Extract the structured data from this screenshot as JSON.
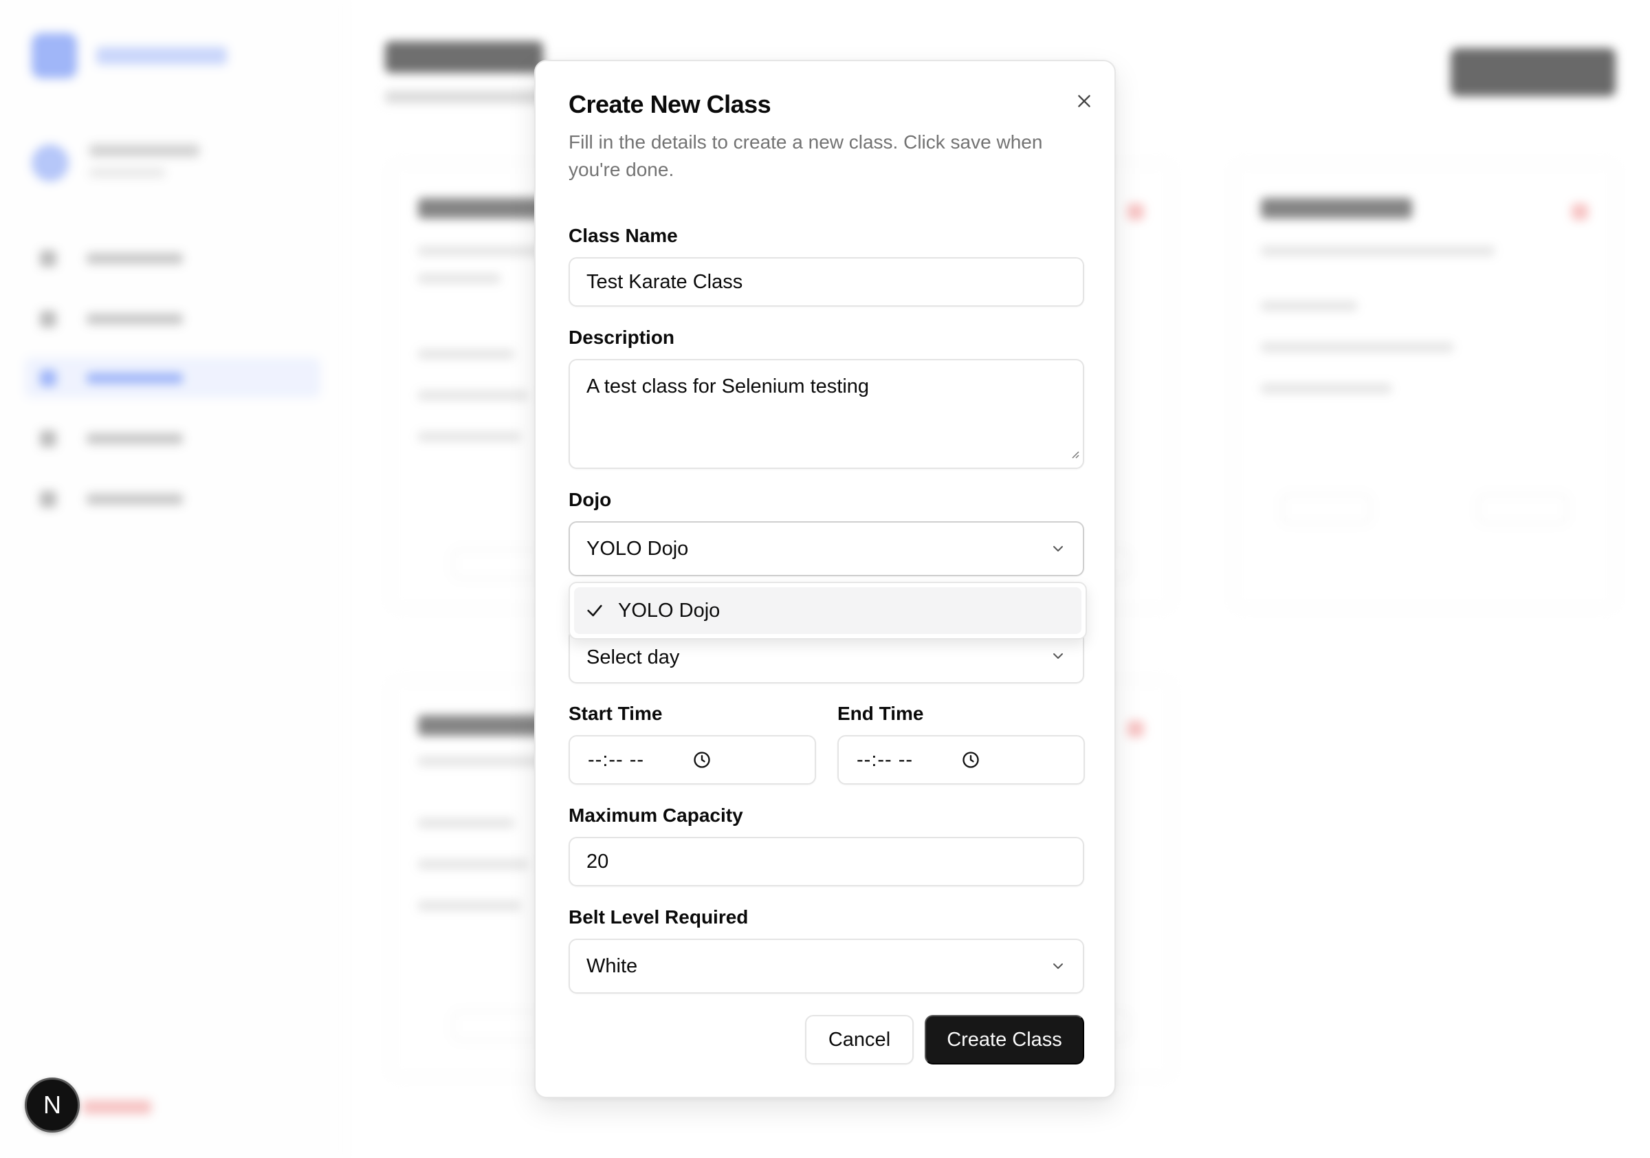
{
  "dialog": {
    "title": "Create New Class",
    "description": "Fill in the details to create a new class. Click save when you're done."
  },
  "form": {
    "class_name": {
      "label": "Class Name",
      "value": "Test Karate Class"
    },
    "description": {
      "label": "Description",
      "value": "A test class for Selenium testing"
    },
    "dojo": {
      "label": "Dojo",
      "value": "YOLO Dojo",
      "options": [
        {
          "label": "YOLO Dojo",
          "selected": true
        }
      ]
    },
    "day": {
      "value": "Select day"
    },
    "start_time": {
      "label": "Start Time",
      "placeholder": "--:-- --"
    },
    "end_time": {
      "label": "End Time",
      "placeholder": "--:-- --"
    },
    "max_capacity": {
      "label": "Maximum Capacity",
      "value": "20"
    },
    "belt_level": {
      "label": "Belt Level Required",
      "value": "White"
    }
  },
  "buttons": {
    "cancel": "Cancel",
    "create": "Create Class"
  },
  "next_badge": {
    "label": "N"
  },
  "icons": {
    "close": "close-icon",
    "chevron": "chevron-down-icon",
    "check": "check-icon",
    "clock": "clock-icon"
  },
  "colors": {
    "primary_button": "#171717",
    "border": "#e4e4e4",
    "muted_text": "#737373",
    "highlight": "#f4f4f5"
  }
}
